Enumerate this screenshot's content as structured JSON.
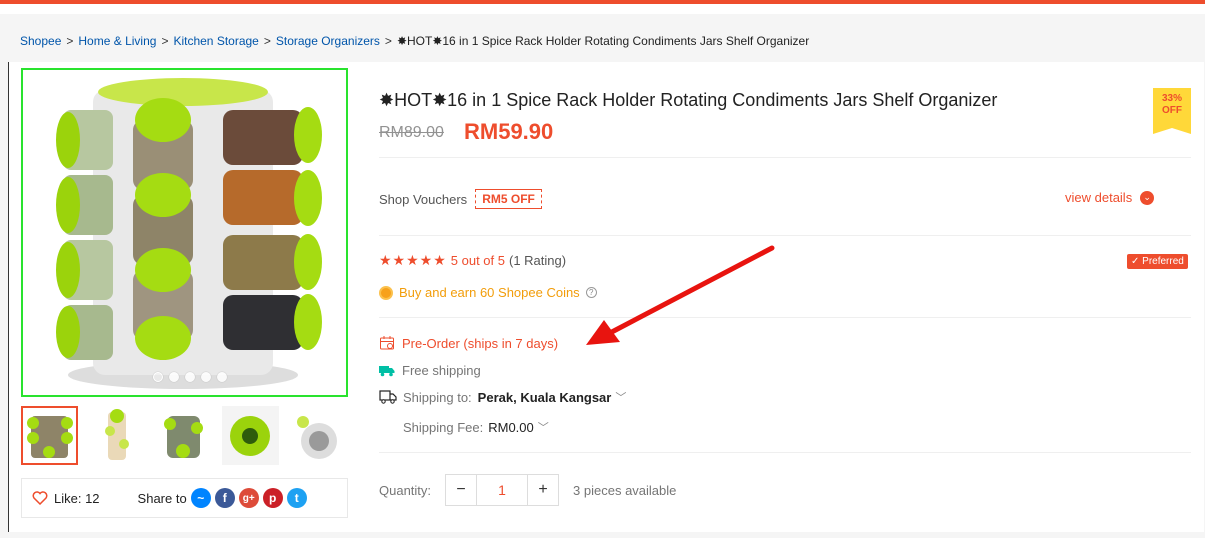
{
  "breadcrumb": {
    "items": [
      "Shopee",
      "Home & Living",
      "Kitchen Storage",
      "Storage Organizers"
    ],
    "current": "✸HOT✸16 in 1 Spice Rack Holder Rotating Condiments Jars Shelf Organizer",
    "separator": ">"
  },
  "product": {
    "title": "✸HOT✸16 in 1 Spice Rack Holder Rotating Condiments Jars Shelf Organizer",
    "discount_badge": {
      "line1": "33%",
      "line2": "OFF"
    },
    "original_price": "RM89.00",
    "price": "RM59.90"
  },
  "vouchers": {
    "label": "Shop Vouchers",
    "voucher": "RM5 OFF",
    "view_details": "view details"
  },
  "rating": {
    "stars": 5,
    "stars_text": "★★★★★",
    "score_text": "5 out of 5",
    "count_text": "(1 Rating)",
    "preferred_label": "✓ Preferred"
  },
  "coins": {
    "text": "Buy and earn 60 Shopee Coins",
    "help_icon": "?"
  },
  "shipping": {
    "preorder": "Pre-Order (ships in 7 days)",
    "free_shipping": "Free shipping",
    "shipping_to_label": "Shipping to:",
    "shipping_to_value": "Perak, Kuala Kangsar",
    "fee_label": "Shipping Fee:",
    "fee_value": "RM0.00"
  },
  "quantity": {
    "label": "Quantity:",
    "minus": "−",
    "value": "1",
    "plus": "+",
    "available": "3 pieces available"
  },
  "social": {
    "like_label": "Like: 12",
    "share_label": "Share to",
    "share_icons": [
      "messenger-icon",
      "facebook-icon",
      "google-plus-icon",
      "pinterest-icon",
      "twitter-icon"
    ],
    "share_glyphs": [
      "~",
      "f",
      "g+",
      "p",
      "t"
    ]
  },
  "colors": {
    "accent": "#ee4d2d",
    "coin": "#f29d0b",
    "free_shipping": "#00bfa5",
    "image_border": "#29e32e",
    "annotation_arrow": "#e8140f"
  },
  "gallery": {
    "slide_count": 5,
    "active_slide": 1,
    "thumbnail_count": 5,
    "active_thumbnail": 1
  }
}
